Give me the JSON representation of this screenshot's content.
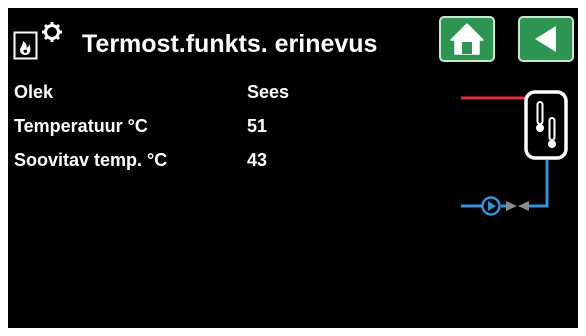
{
  "header": {
    "title": "Termost.funkts. erinevus",
    "mode_icon": "flame-gear-icon",
    "home_icon": "home-icon",
    "back_icon": "back-arrow-icon"
  },
  "params": [
    {
      "label": "Olek",
      "value": "Sees"
    },
    {
      "label": "Temperatuur °C",
      "value": "51"
    },
    {
      "label": "Soovitav temp. °C",
      "value": "43"
    }
  ],
  "schematic": {
    "hot_pipe_color": "#e0323c",
    "cold_pipe_color": "#3a8fd9",
    "icons": [
      "tank-thermometer-icon",
      "pump-icon",
      "valve-icon"
    ]
  },
  "colors": {
    "background": "#000000",
    "button": "#2e9451",
    "text": "#ffffff"
  }
}
